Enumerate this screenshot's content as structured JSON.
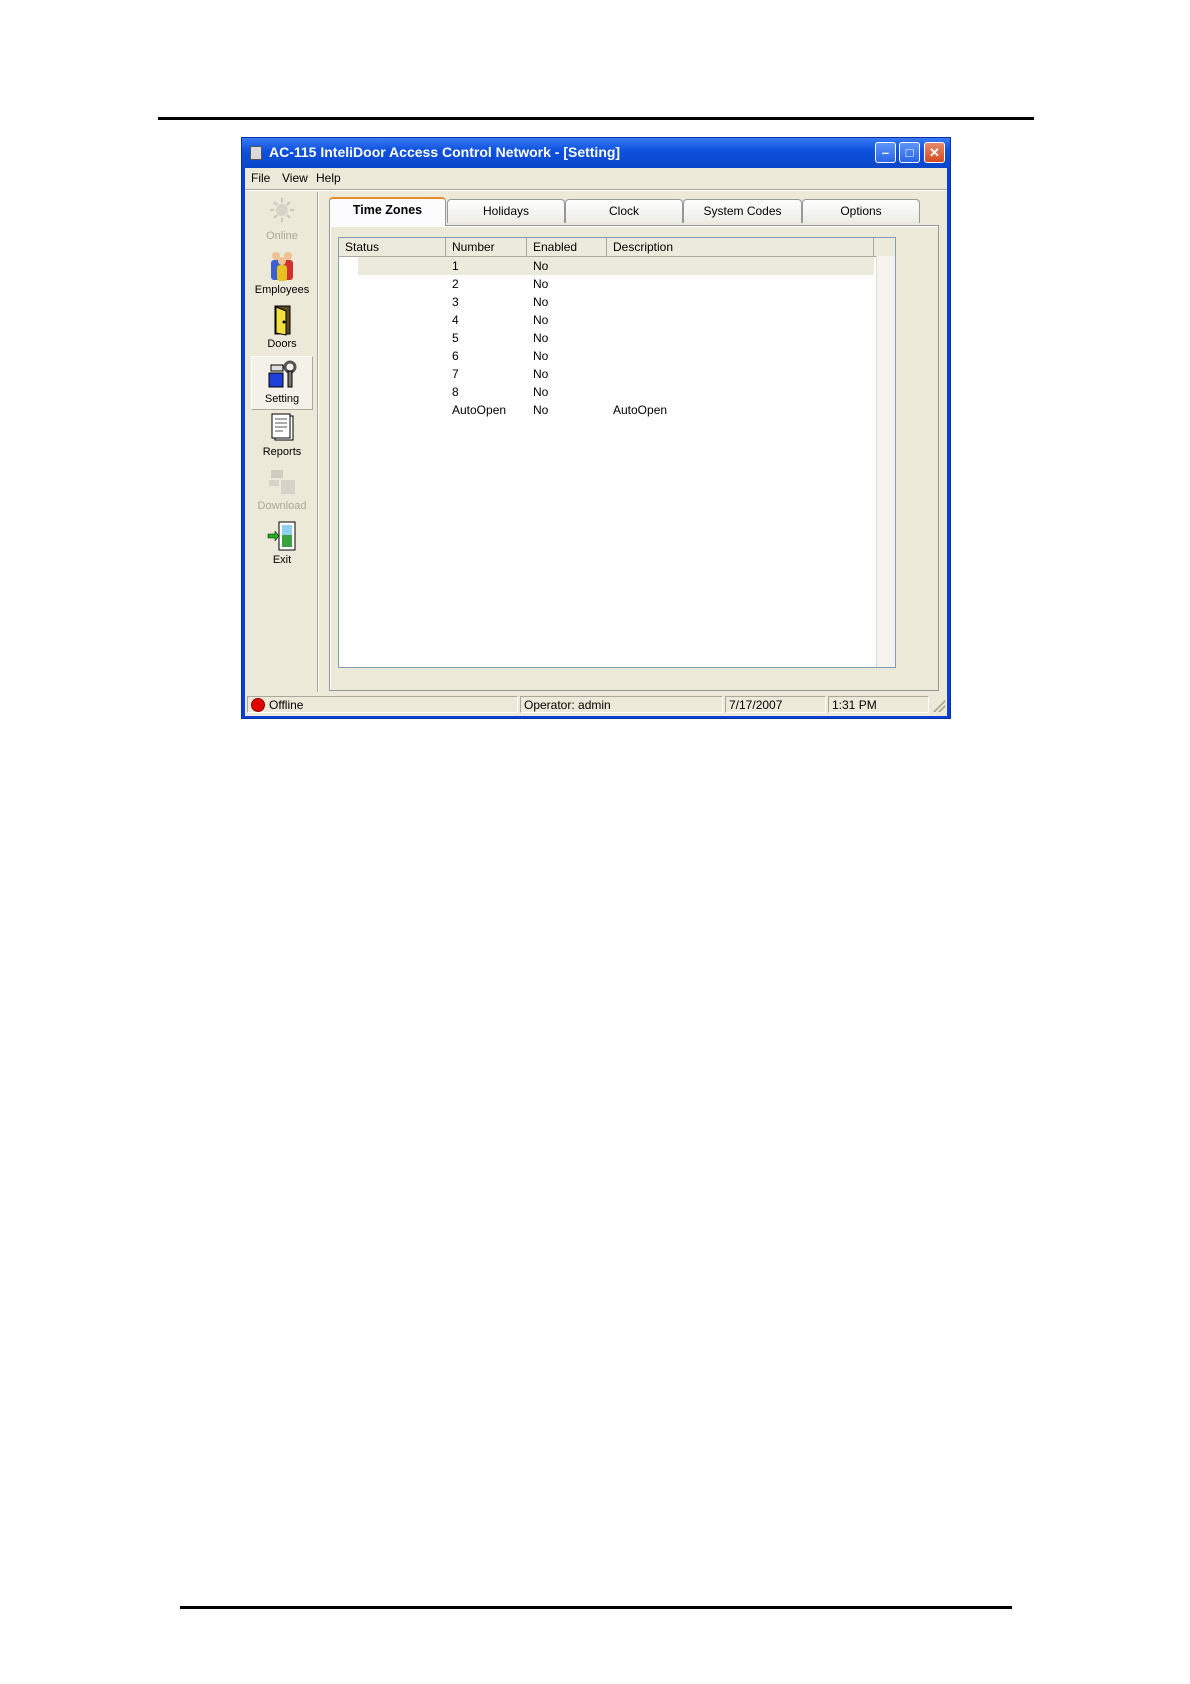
{
  "window": {
    "title": "AC-115 InteliDoor Access Control Network - [Setting]"
  },
  "menu": [
    "File",
    "View",
    "Help"
  ],
  "sidebar": [
    {
      "label": "Online",
      "icon": "online-icon",
      "disabled": true
    },
    {
      "label": "Employees",
      "icon": "employees-icon"
    },
    {
      "label": "Doors",
      "icon": "door-icon"
    },
    {
      "label": "Setting",
      "icon": "setting-icon",
      "active": true
    },
    {
      "label": "Reports",
      "icon": "reports-icon"
    },
    {
      "label": "Download",
      "icon": "download-icon",
      "disabled": true
    },
    {
      "label": "Exit",
      "icon": "exit-icon"
    }
  ],
  "tabs": [
    "Time Zones",
    "Holidays",
    "Clock",
    "System Codes",
    "Options"
  ],
  "active_tab": "Time Zones",
  "table": {
    "columns": [
      "Status",
      "Number",
      "Enabled",
      "Description"
    ],
    "rows": [
      {
        "status": "",
        "number": "1",
        "enabled": "No",
        "description": ""
      },
      {
        "status": "",
        "number": "2",
        "enabled": "No",
        "description": ""
      },
      {
        "status": "",
        "number": "3",
        "enabled": "No",
        "description": ""
      },
      {
        "status": "",
        "number": "4",
        "enabled": "No",
        "description": ""
      },
      {
        "status": "",
        "number": "5",
        "enabled": "No",
        "description": ""
      },
      {
        "status": "",
        "number": "6",
        "enabled": "No",
        "description": ""
      },
      {
        "status": "",
        "number": "7",
        "enabled": "No",
        "description": ""
      },
      {
        "status": "",
        "number": "8",
        "enabled": "No",
        "description": ""
      },
      {
        "status": "",
        "number": "AutoOpen",
        "enabled": "No",
        "description": "AutoOpen"
      }
    ]
  },
  "statusbar": {
    "connection": "Offline",
    "operator": "Operator: admin",
    "date": "7/17/2007",
    "time": "1:31 PM"
  },
  "colors": {
    "titlebar": "#0a46c8",
    "face": "#ece9d8",
    "offline": "#e00000",
    "active_tab_accent": "#e68b2c"
  }
}
